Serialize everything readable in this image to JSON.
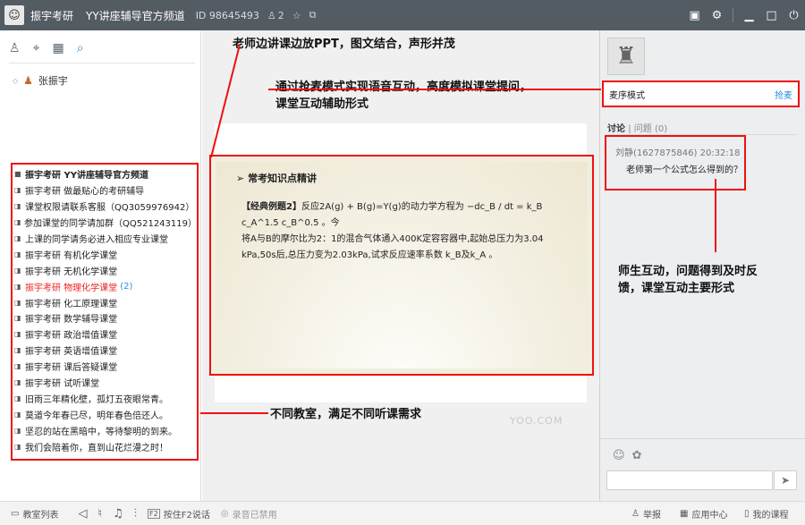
{
  "titlebar": {
    "name": "振宇考研",
    "channel": "YY讲座辅导官方频道",
    "id_text": "ID 98645493",
    "online_count": "2"
  },
  "left": {
    "user_name": "张振宇",
    "channels": [
      {
        "label": "振宇考研   YY讲座辅导官方频道",
        "head": true
      },
      {
        "label": "振宇考研 做最贴心的考研辅导"
      },
      {
        "label": "课堂权限请联系客服（QQ3059976942）"
      },
      {
        "label": "参加课堂的同学请加群（QQ521243119）"
      },
      {
        "label": "上课的同学请务必进入相应专业课堂"
      },
      {
        "label": "振宇考研   有机化学课堂"
      },
      {
        "label": "振宇考研   无机化学课堂"
      },
      {
        "label": "振宇考研   物理化学课堂",
        "active": true,
        "count": "(2)"
      },
      {
        "label": "振宇考研   化工原理课堂"
      },
      {
        "label": "振宇考研   数学辅导课堂"
      },
      {
        "label": "振宇考研   政治增值课堂"
      },
      {
        "label": "振宇考研   英语增值课堂"
      },
      {
        "label": "振宇考研   课后答疑课堂"
      },
      {
        "label": "振宇考研   试听课堂"
      },
      {
        "label": "旧雨三年精化壁，孤灯五夜眼常青。"
      },
      {
        "label": "莫道今年春已尽，明年春色倍还人。"
      },
      {
        "label": "坚忍的站在黑暗中，等待黎明的到来。"
      },
      {
        "label": "我们会陪着你，直到山花烂漫之时！"
      }
    ]
  },
  "annotations": {
    "top": "老师边讲课边放PPT，图文结合，声形并茂",
    "mode_line1": "通过抢麦模式实现语音互动，高度模拟课堂提问，",
    "mode_line2": "课堂互动辅助形式",
    "classroom": "不同教室，满足不同听课需求",
    "interact_line1": "师生互动，问题得到及时反",
    "interact_line2": "馈，课堂互动主要形式"
  },
  "slide": {
    "title": "常考知识点精讲",
    "example": "【经典例题2】",
    "body1": "反应2A(g) + B(g)=Y(g)的动力学方程为 −dc_B / dt = k_B c_A^1.5 c_B^0.5 。今",
    "body2": "将A与B的摩尔比为2：1的混合气体通入400K定容容器中,起始总压力为3.04",
    "body3": "kPa,50s后,总压力变为2.03kPa,试求反应速率系数 k_B及k_A 。",
    "watermark": "YOO.COM"
  },
  "right": {
    "mode": "麦序模式",
    "grab": "抢麦",
    "tab_discuss": "讨论",
    "tab_questions": "问题",
    "question_count": "(0)",
    "q_user": "刘静(1627875846) 20:32:18",
    "q_text": "老师第一个公式怎么得到的？"
  },
  "statusbar": {
    "channel_list": "教室列表",
    "push_to_talk": "按住F2说话",
    "record": "录音已禁用",
    "report": "举报",
    "app_center": "应用中心",
    "my_course": "我的课程"
  },
  "colors": {
    "titlebar": "#535b63",
    "highlight": "#ee1111",
    "link": "#2a8fd6"
  }
}
